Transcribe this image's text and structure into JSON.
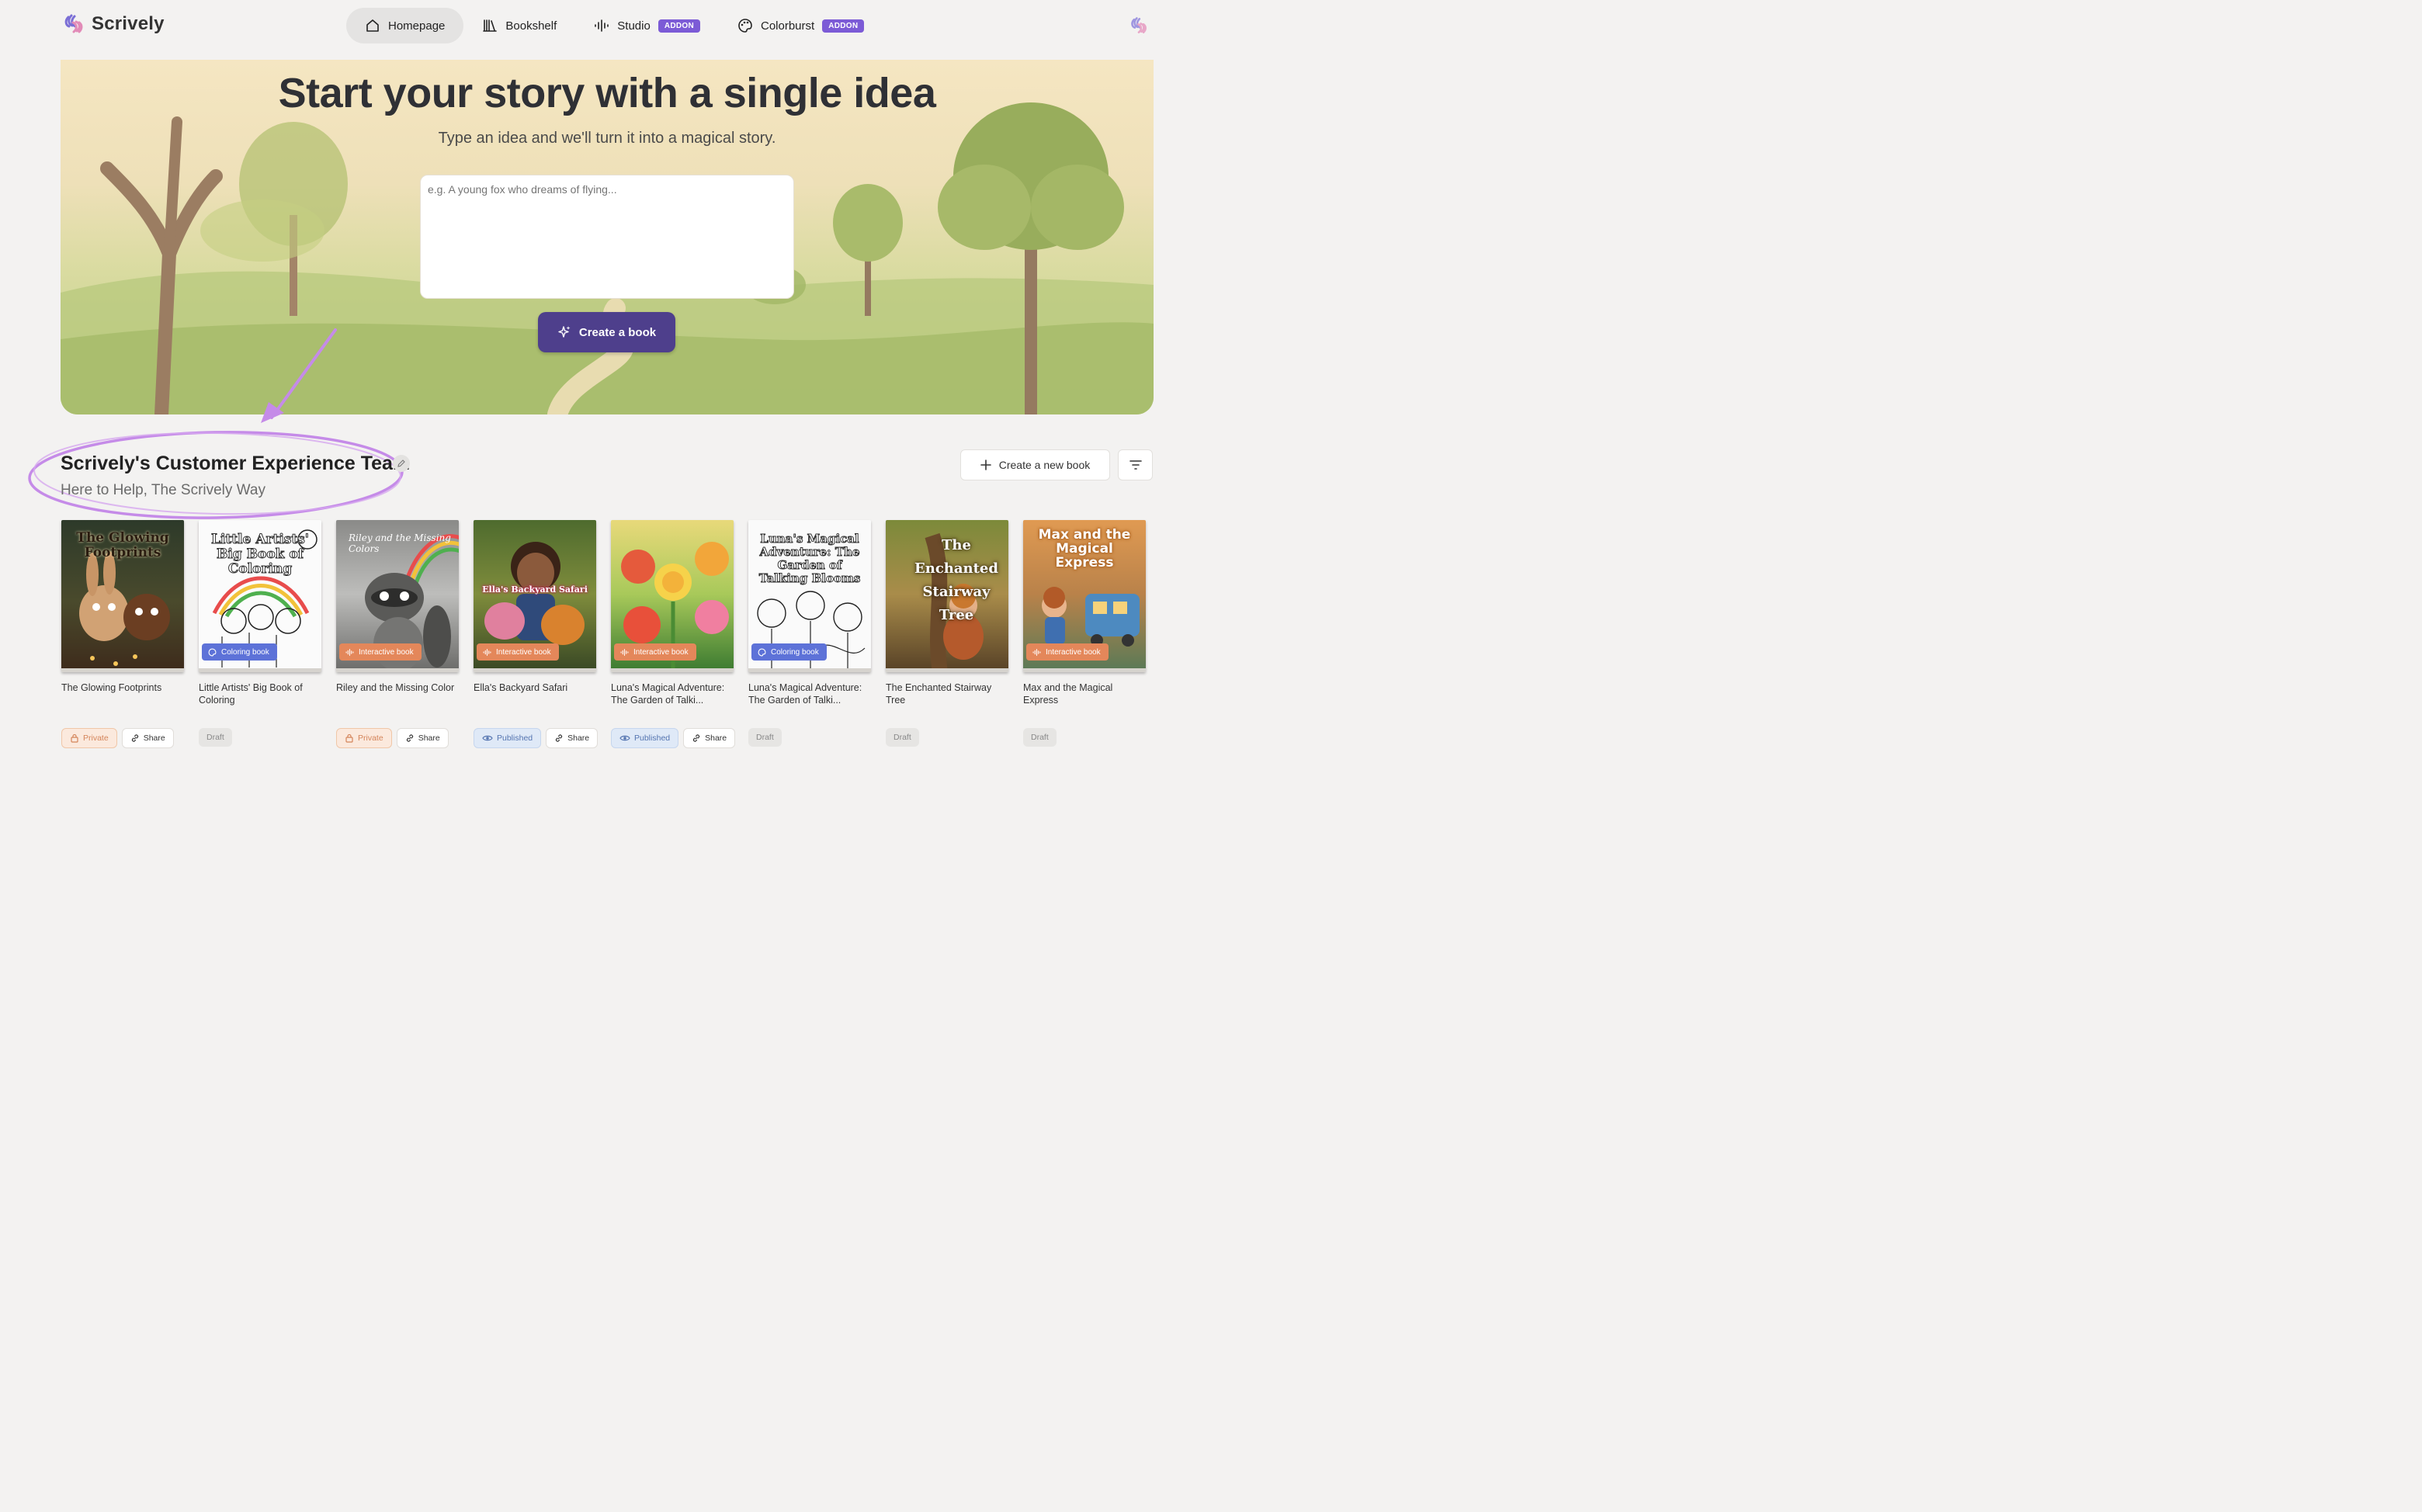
{
  "brand": {
    "name": "Scrively"
  },
  "nav": {
    "items": [
      {
        "label": "Homepage",
        "icon": "home-icon",
        "active": true,
        "badge": ""
      },
      {
        "label": "Bookshelf",
        "icon": "books-icon",
        "active": false,
        "badge": ""
      },
      {
        "label": "Studio",
        "icon": "audio-wave-icon",
        "active": false,
        "badge": "ADDON"
      },
      {
        "label": "Colorburst",
        "icon": "palette-icon",
        "active": false,
        "badge": "ADDON"
      }
    ]
  },
  "hero": {
    "title": "Start your story with a single idea",
    "subtitle": "Type an idea and we'll turn it into a magical story.",
    "placeholder": "e.g. A young fox who dreams of flying...",
    "create_label": "Create a book"
  },
  "team": {
    "title": "Scrively's Customer Experience Team",
    "subtitle": "Here to Help, The Scrively Way",
    "new_book_label": "Create a new book"
  },
  "books": [
    {
      "title": "The Glowing Footprints",
      "cover_text": "The Glowing Footprints",
      "type": "",
      "status": "Private",
      "share": "Share"
    },
    {
      "title": "Little Artists' Big Book of Coloring",
      "cover_text": "Little Artists' Big Book of Coloring",
      "type": "Coloring book",
      "status": "Draft",
      "share": ""
    },
    {
      "title": "Riley and the Missing Color",
      "cover_text": "Riley and the Missing Colors",
      "type": "Interactive book",
      "status": "Private",
      "share": "Share"
    },
    {
      "title": "Ella's Backyard Safari",
      "cover_text": "Ella's Backyard Safari",
      "type": "Interactive book",
      "status": "Published",
      "share": "Share"
    },
    {
      "title": "Luna's Magical Adventure: The Garden of Talki...",
      "cover_text": "",
      "type": "Interactive book",
      "status": "Published",
      "share": "Share"
    },
    {
      "title": "Luna's Magical Adventure: The Garden of Talki...",
      "cover_text": "Luna's Magical Adventure: The Garden of Talking Blooms",
      "type": "Coloring book",
      "status": "Draft",
      "share": ""
    },
    {
      "title": "The Enchanted Stairway Tree",
      "cover_text": "The Enchanted Stairway Tree",
      "type": "",
      "status": "Draft",
      "share": ""
    },
    {
      "title": "Max and the Magical Express",
      "cover_text": "Max and the Magical Express",
      "type": "Interactive book",
      "status": "Draft",
      "share": ""
    }
  ],
  "colors": {
    "accent": "#4e3f8c",
    "addon": "#7c5bd6",
    "annotation": "#c58be8"
  }
}
